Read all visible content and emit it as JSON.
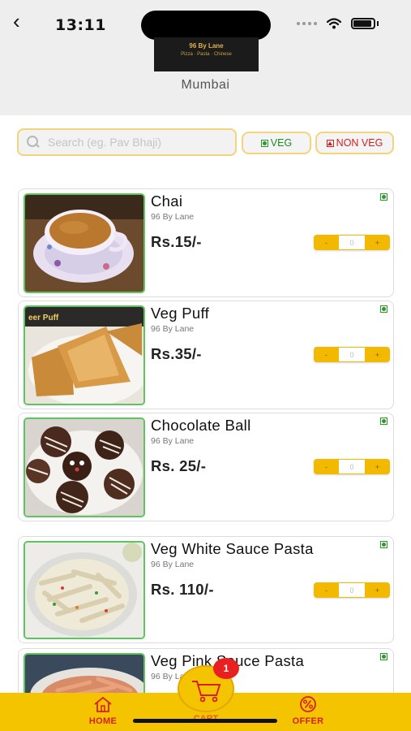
{
  "status_bar": {
    "time": "13:11"
  },
  "header": {
    "city": "Mumbai",
    "logo_text": "96 By Lane",
    "logo_subtext": "Pizza · Pasta · Chinese"
  },
  "search": {
    "placeholder": "Search (eg. Pav Bhaji)",
    "value": ""
  },
  "filters": {
    "veg_label": "VEG",
    "nonveg_label": "NON VEG"
  },
  "items": [
    {
      "name": "Chai",
      "vendor": "96 By Lane",
      "price": "Rs.15/-",
      "qty": "0",
      "photo": "tea-cup"
    },
    {
      "name": "Veg Puff",
      "vendor": "96 By Lane",
      "price": "Rs.35/-",
      "qty": "0",
      "photo": "puff-pastry",
      "photo_caption": "eer Puff"
    },
    {
      "name": "Chocolate Ball",
      "vendor": "96 By Lane",
      "price": "Rs. 25/-",
      "qty": "0",
      "photo": "chocolate-balls"
    },
    {
      "name": "Veg White Sauce Pasta",
      "vendor": "96 By Lane",
      "price": "Rs. 110/-",
      "qty": "0",
      "photo": "white-pasta"
    },
    {
      "name": "Veg Pink Sauce Pasta",
      "vendor": "96 By Lane",
      "price": "",
      "qty": "0",
      "photo": "pink-pasta"
    }
  ],
  "stepper": {
    "minus": "-",
    "plus": "+"
  },
  "bottom_nav": {
    "home_label": "HOME",
    "cart_label": "CART",
    "offer_label": "OFFER",
    "cart_count": "1"
  },
  "colors": {
    "accent": "#f5c400",
    "nav_text": "#d52020",
    "veg_green": "#2a9a2a",
    "nonveg_red": "#d42020"
  },
  "icons": {
    "back": "chevron-left-icon",
    "search": "search-icon",
    "home": "home-icon",
    "cart": "cart-icon",
    "offer": "percent-icon"
  }
}
